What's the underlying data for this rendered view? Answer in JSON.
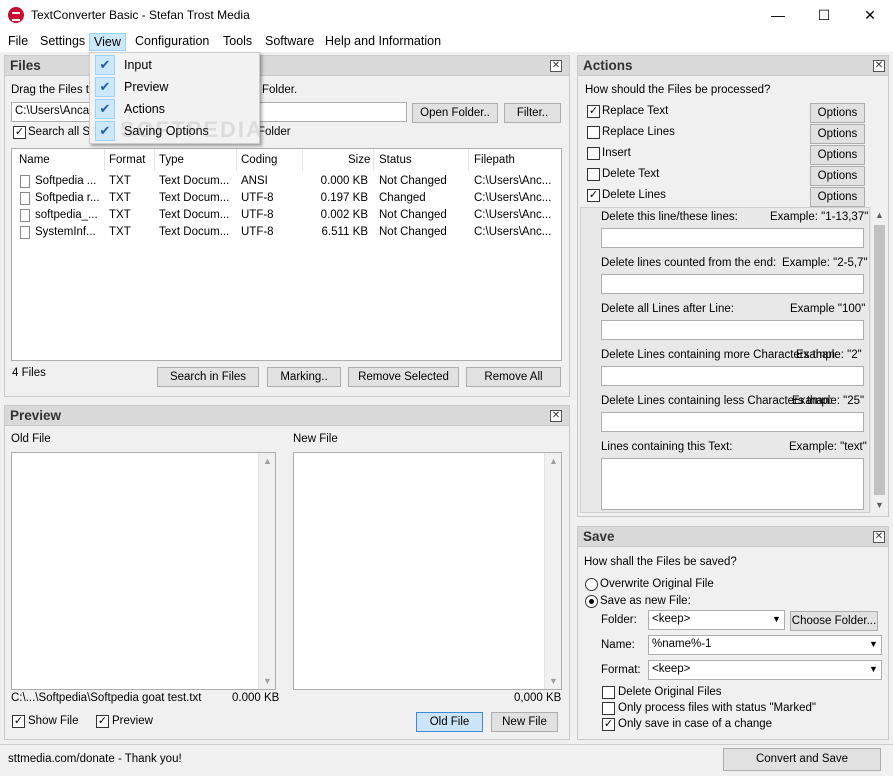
{
  "window": {
    "title": "TextConverter Basic - Stefan Trost Media",
    "minimize": "—",
    "maximize": "☐",
    "close": "✕"
  },
  "menubar": {
    "file": "File",
    "settings": "Settings",
    "view": "View",
    "configuration": "Configuration",
    "tools": "Tools",
    "software": "Software",
    "help": "Help and Information"
  },
  "view_menu": {
    "items": [
      {
        "label": "Input",
        "checked": true
      },
      {
        "label": "Preview",
        "checked": true
      },
      {
        "label": "Actions",
        "checked": true
      },
      {
        "label": "Saving Options",
        "checked": true
      }
    ]
  },
  "files_panel": {
    "title": "Files",
    "drag_hint": "Drag the Files to",
    "drag_hint_tail": "Folder.",
    "path_value": "C:\\Users\\Anca-",
    "open_folder": "Open Folder..",
    "filter": "Filter..",
    "search_subfolders": "Search all Su",
    "search_tail": "Folder",
    "columns": [
      "Name",
      "Format",
      "Type",
      "Coding",
      "Size",
      "Status",
      "Filepath"
    ],
    "rows": [
      {
        "name": "Softpedia ...",
        "format": "TXT",
        "type": "Text Docum...",
        "coding": "ANSI",
        "size": "0.000 KB",
        "status": "Not Changed",
        "path": "C:\\Users\\Anc..."
      },
      {
        "name": "Softpedia r...",
        "format": "TXT",
        "type": "Text Docum...",
        "coding": "UTF-8",
        "size": "0.197 KB",
        "status": "Changed",
        "path": "C:\\Users\\Anc..."
      },
      {
        "name": "softpedia_...",
        "format": "TXT",
        "type": "Text Docum...",
        "coding": "UTF-8",
        "size": "0.002 KB",
        "status": "Not Changed",
        "path": "C:\\Users\\Anc..."
      },
      {
        "name": "SystemInf...",
        "format": "TXT",
        "type": "Text Docum...",
        "coding": "UTF-8",
        "size": "6.511 KB",
        "status": "Not Changed",
        "path": "C:\\Users\\Anc..."
      }
    ],
    "count": "4 Files",
    "search_in_files": "Search in Files",
    "marking": "Marking..",
    "remove_selected": "Remove Selected",
    "remove_all": "Remove All"
  },
  "preview_panel": {
    "title": "Preview",
    "old_file": "Old File",
    "new_file": "New File",
    "old_path": "C:\\...\\Softpedia\\Softpedia goat test.txt",
    "old_size": "0.000 KB",
    "new_size": "0,000 KB",
    "show_file": "Show File",
    "preview": "Preview",
    "old_file_btn": "Old File",
    "new_file_btn": "New File"
  },
  "actions_panel": {
    "title": "Actions",
    "question": "How should the Files be processed?",
    "options_label": "Options",
    "actions": [
      {
        "label": "Replace Text",
        "checked": true
      },
      {
        "label": "Replace Lines",
        "checked": false
      },
      {
        "label": "Insert",
        "checked": false
      },
      {
        "label": "Delete Text",
        "checked": false
      },
      {
        "label": "Delete Lines",
        "checked": true
      }
    ],
    "fields": [
      {
        "label": "Delete this line/these lines:",
        "example": "Example: \"1-13,37\""
      },
      {
        "label": "Delete lines counted from the end:",
        "example": "Example: \"2-5,7\""
      },
      {
        "label": "Delete all Lines after Line:",
        "example": "Example \"100\""
      },
      {
        "label": "Delete Lines containing more Characters than:",
        "example": "Example: \"2\""
      },
      {
        "label": "Delete Lines containing less Characters than:",
        "example": "Example: \"25\""
      },
      {
        "label": "Lines containing this Text:",
        "example": "Example: \"text\""
      }
    ]
  },
  "save_panel": {
    "title": "Save",
    "question": "How shall the Files be saved?",
    "overwrite": "Overwrite Original File",
    "save_new": "Save as new File:",
    "folder_label": "Folder:",
    "folder_value": "<keep>",
    "choose_folder": "Choose Folder...",
    "name_label": "Name:",
    "name_value": "%name%-1",
    "format_label": "Format:",
    "format_value": "<keep>",
    "delete_original": "Delete Original Files",
    "only_marked": "Only process files with status \"Marked\"",
    "only_changed": "Only save in case of a change"
  },
  "status": {
    "donate": "sttmedia.com/donate - Thank you!",
    "convert": "Convert and Save"
  },
  "watermark": "SOFTPEDIA"
}
